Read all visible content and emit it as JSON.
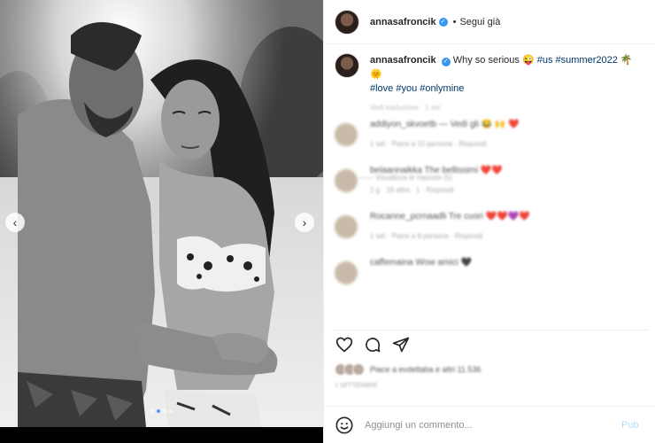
{
  "header": {
    "username": "annasafroncik",
    "separator": "•",
    "follow_status": "Segui già"
  },
  "caption": {
    "username": "annasafroncik",
    "text": "Why so serious 😜",
    "tags_line1": "#us #summer2022",
    "emoji_end": "🌴 🌞",
    "tags_line2": "#love #you #onlymine",
    "meta": "Vedi traduzione · 1 set"
  },
  "comments": [
    {
      "text": "addiyon_skvoetb — Vedi gli 😂 🙌 ❤️",
      "meta": "1 set · Piace a 10 persone · Rispondi"
    },
    {
      "text": "belaannaikka The bellissimi ❤️❤️",
      "meta": "1 g · 19 altre · 1 · Rispondi"
    },
    {
      "text": "Rocanne_pcrnaadli Tre cuori ❤️❤️💜❤️",
      "meta": "1 set · Piace a 8 persone · Rispondi"
    },
    {
      "text": "caffemaina Wow amici 🖤",
      "meta": ""
    }
  ],
  "replies_label": "——  Visualizza le risposte (5)",
  "likes": {
    "text": "Piace a evdeltaba e altri 11.536"
  },
  "post_date": "1 SETTEMBRE",
  "comment_box": {
    "placeholder": "Aggiungi un commento...",
    "publish_label": "Pub"
  },
  "carousel": {
    "total": 4,
    "active_index": 1
  },
  "colors": {
    "verified": "#3897f0",
    "tag_link": "#00376b",
    "active_dot": "#4aa0ff",
    "publish_disabled": "#b2dffc"
  }
}
